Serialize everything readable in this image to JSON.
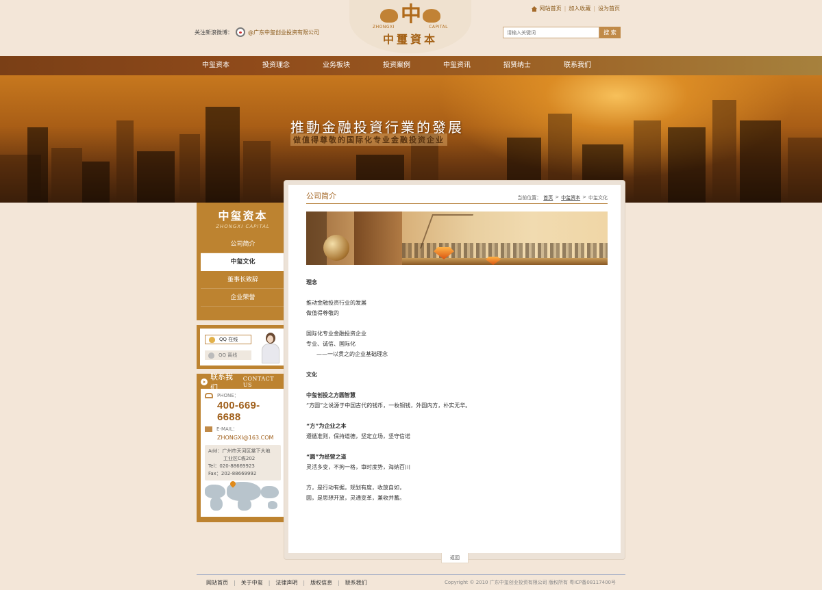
{
  "header": {
    "weibo_label": "关注新浪微博：",
    "weibo_link": "@广东中玺创业投资有限公司",
    "logo_mark": "中",
    "logo_en_left": "ZHONGXI",
    "logo_en_right": "CAPITAL",
    "logo_cn": "中璽資本",
    "top_links": [
      "网站首页",
      "加入收藏",
      "设为首页"
    ],
    "search_placeholder": "请输入关键词",
    "search_button": "搜 索"
  },
  "nav": {
    "items": [
      "中玺资本",
      "投资理念",
      "业务板块",
      "投资案例",
      "中玺资讯",
      "招贤纳士",
      "联系我们"
    ]
  },
  "banner": {
    "slogan": "推動金融投資行業的發展",
    "slogan_sub": "做值得尊敬的国际化专业金融投资企业"
  },
  "sidebar": {
    "logo_cn": "中玺资本",
    "logo_en": "ZHONGXI  CAPITAL",
    "items": [
      {
        "label": "公司简介",
        "active": false
      },
      {
        "label": "中玺文化",
        "active": true
      },
      {
        "label": "董事长致辞",
        "active": false
      },
      {
        "label": "企业荣誉",
        "active": false
      }
    ],
    "qq_online": "QQ 在线",
    "qq_offline": "QQ 离线",
    "contact_title_cn": "联系我们",
    "contact_title_en": "CONTACT US",
    "phone_label": "PHONE：",
    "phone": "400-669-6688",
    "email_label": "E-MAIL：",
    "email": "ZHONGXI@163.COM",
    "address_lines": [
      "Add：广州市天河区棠下大地",
      "工业区C栋202",
      "Tel：020-88669923",
      "Fax：202-88669992"
    ]
  },
  "main": {
    "title": "公司简介",
    "breadcrumb_prefix": "当前位置：",
    "breadcrumb": [
      "首页",
      "中玺资本",
      "中玺文化"
    ],
    "breadcrumb_sep": ">",
    "article": [
      {
        "text": "理念",
        "style": "b"
      },
      {
        "text": "",
        "style": ""
      },
      {
        "text": "推动金融投资行业的发展",
        "style": ""
      },
      {
        "text": "做值得尊敬的",
        "style": ""
      },
      {
        "text": "",
        "style": ""
      },
      {
        "text": "国际化专业金融投资企业",
        "style": ""
      },
      {
        "text": "专业、诚信、国际化",
        "style": ""
      },
      {
        "text": "——一以贯之的企业基础理念",
        "style": "ind"
      },
      {
        "text": "",
        "style": ""
      },
      {
        "text": "文化",
        "style": "b"
      },
      {
        "text": "",
        "style": ""
      },
      {
        "text": "中玺创投之方圆智慧",
        "style": "b"
      },
      {
        "text": "“方圆”之说源于中国古代的钱币，一枚铜钱，外圆内方，朴实无华。",
        "style": ""
      },
      {
        "text": "",
        "style": ""
      },
      {
        "text": "“方”为企业之本",
        "style": "b"
      },
      {
        "text": "遵循准则，保持道德，坚定立场，坚守信诺",
        "style": ""
      },
      {
        "text": "",
        "style": ""
      },
      {
        "text": "“圆”为经营之道",
        "style": "b"
      },
      {
        "text": "灵活多变，不拘一格，审时度势，海纳百川",
        "style": ""
      },
      {
        "text": "",
        "style": ""
      },
      {
        "text": "方，是行动有据，规划有度，收放自如，",
        "style": ""
      },
      {
        "text": "圆，是思想开放，灵通变革，兼收并蓄。",
        "style": ""
      }
    ],
    "back_label": "返回"
  },
  "footer": {
    "links": [
      "网站首页",
      "关于中玺",
      "法律声明",
      "版权信息",
      "联系我们"
    ],
    "copyright": "Copyright © 2010 广东中玺创业投资有限公司 版权所有 粤ICP备08117400号"
  },
  "colors": {
    "accent": "#bd8330",
    "nav_dark": "#7a3f16",
    "text_link": "#a0601c",
    "page_bg": "#f3e6d8"
  }
}
